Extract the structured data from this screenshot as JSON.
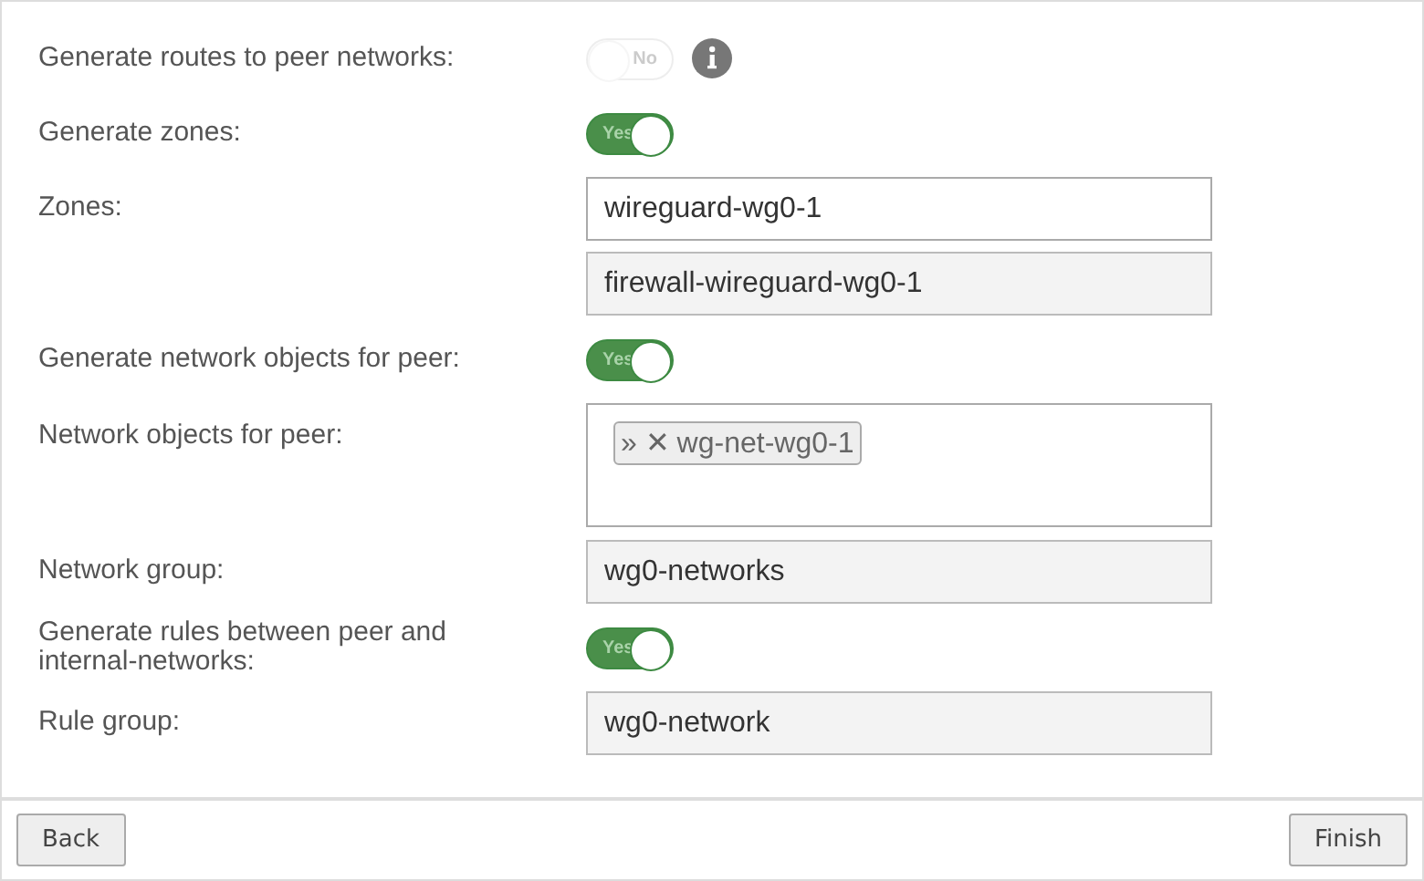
{
  "rows": [
    {
      "kind": "toggle",
      "label": "Generate routes to peer networks:",
      "toggle": {
        "text": "No",
        "on": false,
        "disabled": true
      },
      "info": true
    },
    {
      "kind": "toggle",
      "label": "Generate zones:",
      "toggle": {
        "text": "Yes",
        "on": true,
        "disabled": false
      }
    },
    {
      "kind": "fields",
      "label": "Zones:",
      "fields": [
        {
          "value": "wireguard-wg0-1",
          "disabled": false
        },
        {
          "value": "firewall-wireguard-wg0-1",
          "disabled": true
        }
      ]
    },
    {
      "kind": "toggle",
      "label": "Generate network objects for peer:",
      "toggle": {
        "text": "Yes",
        "on": true,
        "disabled": false
      }
    },
    {
      "kind": "tags",
      "label": "Network objects for peer:",
      "tags": [
        {
          "prefix": "»",
          "remove": "✕",
          "text": "wg-net-wg0-1"
        }
      ]
    },
    {
      "kind": "fields",
      "label": "Network group:",
      "fields": [
        {
          "value": "wg0-networks",
          "disabled": true
        }
      ]
    },
    {
      "kind": "toggle",
      "label": "Generate rules between peer and internal-networks:",
      "toggle": {
        "text": "Yes",
        "on": true,
        "disabled": false
      }
    },
    {
      "kind": "fields",
      "label": "Rule group:",
      "fields": [
        {
          "value": "wg0-network",
          "disabled": true
        }
      ]
    }
  ],
  "footer": {
    "back": "Back",
    "finish": "Finish"
  }
}
